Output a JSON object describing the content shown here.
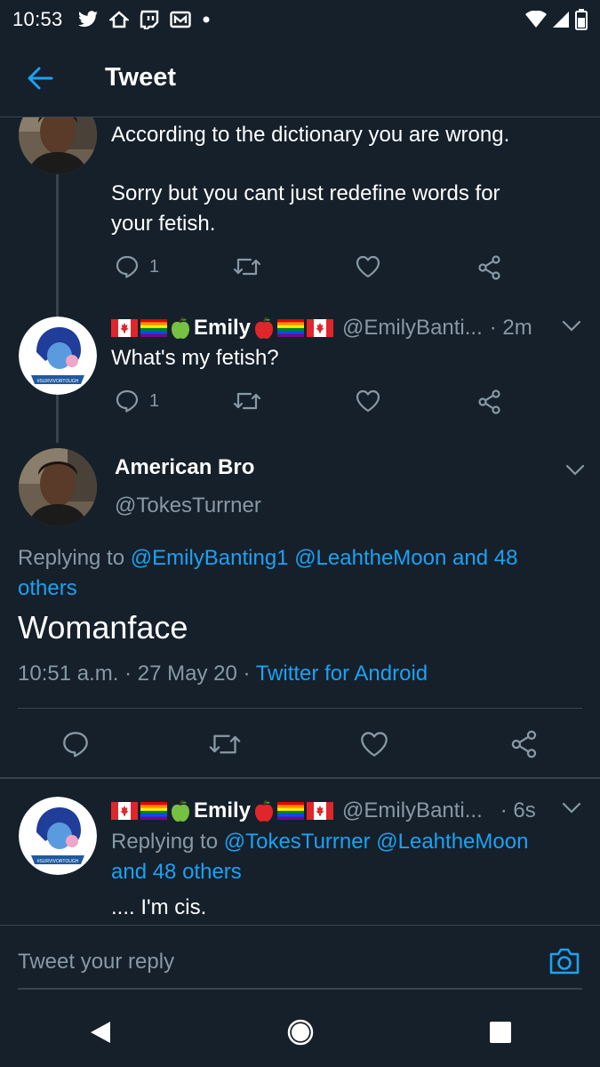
{
  "status_bar": {
    "time": "10:53"
  },
  "app_bar": {
    "title": "Tweet"
  },
  "tweets": [
    {
      "text_line1": "According to the dictionary you are wrong.",
      "text_line2": "Sorry but you cant just redefine words for",
      "text_line3": "your fetish.",
      "reply_count": "1"
    },
    {
      "display_name": "Emily",
      "handle": "@EmilyBanti...",
      "time": "· 2m",
      "text": "What's my fetish?",
      "reply_count": "1"
    }
  ],
  "main_tweet": {
    "display_name": "American Bro",
    "handle": "@TokesTurrner",
    "replying_prefix": "Replying to",
    "replying_users": "@EmilyBanting1 @LeahtheMoon and 48",
    "replying_others": "others",
    "text": "Womanface",
    "time": "10:51 a.m.",
    "date": "27 May 20",
    "source": "Twitter for Android"
  },
  "reply_tweet": {
    "display_name": "Emily",
    "handle": "@EmilyBanti...",
    "time": "· 6s",
    "replying_prefix": "Replying to",
    "replying_users": "@TokesTurrner @LeahtheMoon",
    "replying_others": "and 48 others",
    "text": ".... I'm cis."
  },
  "avatar_badge_text": "#SURVIVORTOUGH",
  "reply_box": {
    "placeholder": "Tweet your reply"
  },
  "colors": {
    "background": "#15202b",
    "accent": "#1da1f2",
    "muted": "#8899a6",
    "divider": "#38444d"
  },
  "icons": [
    "back-arrow-icon",
    "reply-icon",
    "retweet-icon",
    "like-icon",
    "share-icon",
    "chevron-down-icon",
    "camera-icon",
    "nav-back-icon",
    "nav-home-icon",
    "nav-recents-icon"
  ]
}
